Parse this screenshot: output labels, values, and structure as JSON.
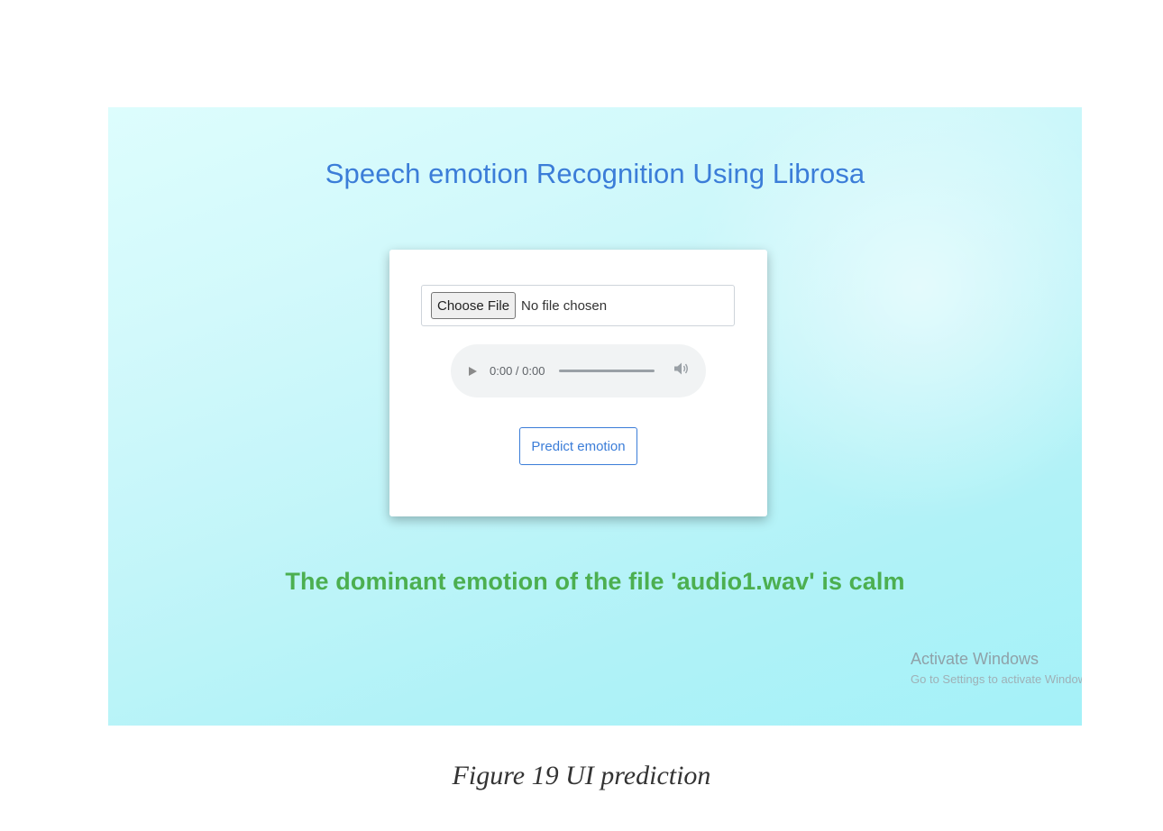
{
  "page": {
    "title": "Speech emotion Recognition Using Librosa",
    "file_input": {
      "button_label": "Choose File",
      "status_text": "No file chosen"
    },
    "audio_player": {
      "time_display": "0:00 / 0:00",
      "progress": 0,
      "play_icon": "play-icon",
      "volume_icon": "volume-icon"
    },
    "predict_button_label": "Predict emotion",
    "result_text": "The dominant emotion of the file 'audio1.wav' is calm",
    "colors": {
      "title": "#3b7dd8",
      "result": "#4caf50",
      "button_accent": "#3b7dd8"
    }
  },
  "watermark": {
    "title": "Activate Windows",
    "subtitle": "Go to Settings to activate Windows."
  },
  "caption": "Figure 19 UI prediction"
}
